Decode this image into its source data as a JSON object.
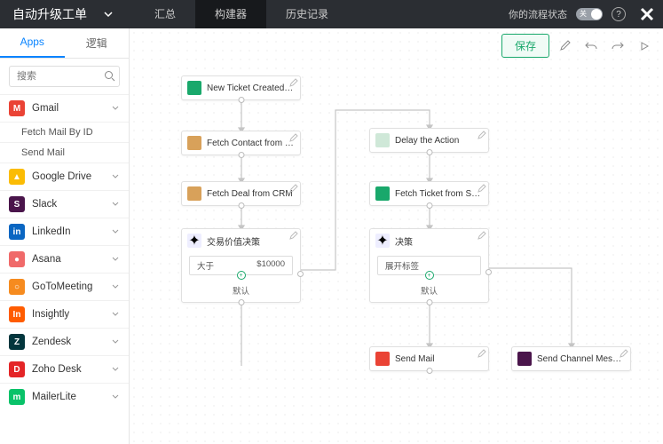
{
  "header": {
    "title": "自动升级工单",
    "tabs": [
      "汇总",
      "构建器",
      "历史记录"
    ],
    "status_label": "你的流程状态",
    "toggle_label": "关",
    "save_label": "保存"
  },
  "side": {
    "tabs": [
      "Apps",
      "逻辑"
    ],
    "search_placeholder": "搜索"
  },
  "apps": [
    {
      "name": "Gmail",
      "color": "#ea4335",
      "char": "M",
      "subs": [
        "Fetch Mail By ID",
        "Send Mail"
      ]
    },
    {
      "name": "Google Drive",
      "color": "#fbbc04",
      "char": "▲"
    },
    {
      "name": "Slack",
      "color": "#4a154b",
      "char": "S"
    },
    {
      "name": "LinkedIn",
      "color": "#0a66c2",
      "char": "in"
    },
    {
      "name": "Asana",
      "color": "#f06a6a",
      "char": "●"
    },
    {
      "name": "GoToMeeting",
      "color": "#f68b1f",
      "char": "○"
    },
    {
      "name": "Insightly",
      "color": "#ff5c00",
      "char": "In"
    },
    {
      "name": "Zendesk",
      "color": "#03363d",
      "char": "Z"
    },
    {
      "name": "Zoho Desk",
      "color": "#e42527",
      "char": "D"
    },
    {
      "name": "MailerLite",
      "color": "#09c269",
      "char": "m"
    }
  ],
  "nodes": {
    "n1": {
      "label": "New Ticket Created in ...",
      "icon": "desk"
    },
    "n2": {
      "label": "Fetch Contact from CRM",
      "icon": "crm"
    },
    "n3": {
      "label": "Fetch Deal from CRM",
      "icon": "crm"
    },
    "d1": {
      "label": "交易价值决策",
      "cond_left": "大于",
      "cond_right": "$10000",
      "default": "默认",
      "icon": "decision"
    },
    "n4": {
      "label": "Delay the Action",
      "icon": "delay"
    },
    "n5": {
      "label": "Fetch Ticket from Supp...",
      "icon": "desk"
    },
    "d2": {
      "label": "决策",
      "cond_left": "展开标签",
      "cond_right": "",
      "default": "默认",
      "icon": "decision"
    },
    "n6": {
      "label": "Send Mail",
      "icon": "gmail"
    },
    "n7": {
      "label": "Send Channel Message",
      "icon": "slack"
    }
  }
}
